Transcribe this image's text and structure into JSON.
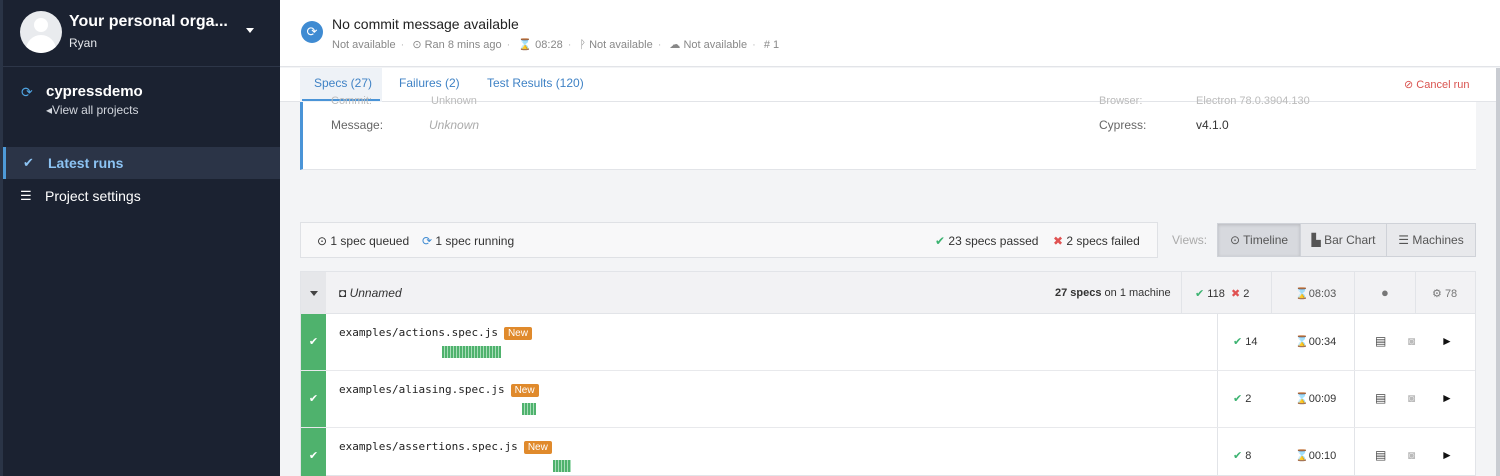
{
  "sidebar": {
    "org_name": "Your personal orga...",
    "org_user": "Ryan",
    "project_name": "cypressdemo",
    "view_all": "View all projects",
    "nav": [
      {
        "label": "Latest runs",
        "active": true
      },
      {
        "label": "Project settings",
        "active": false
      }
    ]
  },
  "run": {
    "title": "No commit message available",
    "branch": "Not available",
    "ran": "Ran 8 mins ago",
    "duration": "08:28",
    "commit": "Not available",
    "ci": "Not available",
    "number": "1"
  },
  "tabs": [
    {
      "label": "Specs (27)"
    },
    {
      "label": "Failures (2)"
    },
    {
      "label": "Test Results (120)"
    }
  ],
  "cancel_run": "Cancel run",
  "info": {
    "commit_label": "Commit:",
    "commit_value": "Unknown",
    "message_label": "Message:",
    "message_value": "Unknown",
    "browser_label": "Browser:",
    "browser_value": "Electron 78.0.3904.130",
    "cypress_label": "Cypress:",
    "cypress_value": "v4.1.0"
  },
  "summary": {
    "queued": "1 spec queued",
    "running": "1 spec running",
    "passed": "23 specs passed",
    "failed": "2 specs failed"
  },
  "views": {
    "label": "Views:",
    "options": [
      "Timeline",
      "Bar Chart",
      "Machines"
    ],
    "selected": "Timeline"
  },
  "group": {
    "name": "Unnamed",
    "specs_count": "27 specs",
    "specs_suffix": "on 1 machine",
    "passed": "118",
    "failed": "2",
    "duration": "08:03",
    "browser_version": "78"
  },
  "specs": [
    {
      "name": "examples/actions.spec.js",
      "badge": "New",
      "passed": "14",
      "duration": "00:34"
    },
    {
      "name": "examples/aliasing.spec.js",
      "badge": "New",
      "passed": "2",
      "duration": "00:09"
    },
    {
      "name": "examples/assertions.spec.js",
      "badge": "New",
      "passed": "8",
      "duration": "00:10"
    }
  ],
  "colors": {
    "sidebar_bg": "#1b2231",
    "accent": "#3f8bd2",
    "pass": "#4fb26d",
    "fail": "#e05252",
    "badge_new": "#e08a2c"
  }
}
